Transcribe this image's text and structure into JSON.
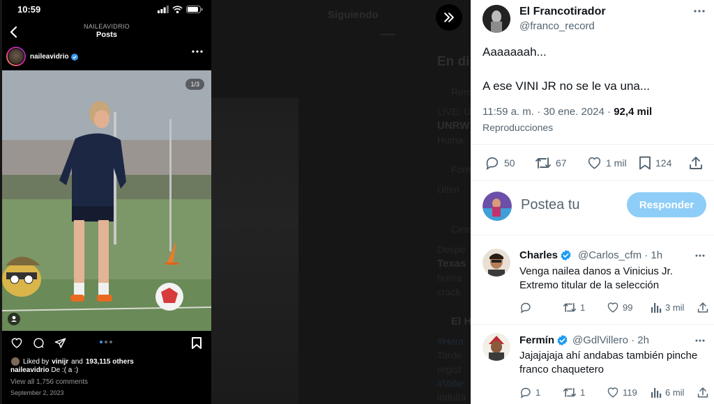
{
  "background": {
    "tab_title": "Siguiendo",
    "trending_lines": [
      "En di",
      "Rem",
      "LIVE: U",
      "UNRW",
      "Huma",
      "Fore",
      "Últim",
      "Cess",
      "Despe",
      "Texas",
      "huma",
      "crack",
      "El H",
      "#Hera",
      "Tarde",
      "regist",
      "#Valie",
      "indulta"
    ]
  },
  "instagram": {
    "time": "10:59",
    "username_header": "NAILEAVIDRIO",
    "page_title": "Posts",
    "handle": "naileavidrio",
    "photo_counter": "1/3",
    "liked_by_prefix": "Liked by",
    "liked_by_user": "vinijr",
    "liked_by_and": "and",
    "liked_by_count": "193,115 others",
    "caption_user": "naileavidrio",
    "caption_text": "De :( a :)",
    "view_comments": "View all 1,756 comments",
    "date": "September 2, 2023",
    "carousel_total": 3,
    "carousel_active": 1
  },
  "tweet": {
    "author_name": "El Francotirador",
    "author_handle": "@franco_record",
    "body_line1": "Aaaaaaah...",
    "body_line2": "A ese VINI JR no se le va una...",
    "time": "11:59 a. m. · 30 ene. 2024 ·",
    "views_count": "92,4 mil",
    "views_label": "Reproducciones",
    "replies": "50",
    "reposts": "67",
    "likes": "1 mil",
    "bookmarks": "124"
  },
  "composer": {
    "placeholder": "Postea tu",
    "reply_button": "Responder"
  },
  "replies": [
    {
      "name": "Charles",
      "handle": "@Carlos_cfm · 1h",
      "line1": "Venga nailea danos a Vinicius Jr.",
      "line2": "Extremo titular de la selección",
      "replies": "",
      "reposts": "1",
      "likes": "99",
      "views": "3 mil"
    },
    {
      "name": "Fermín",
      "handle": "@GdlVillero · 2h",
      "line1": "Jajajajaja ahí andabas también pinche",
      "line2": "franco chaquetero",
      "replies": "1",
      "reposts": "1",
      "likes": "119",
      "views": "6 mil"
    }
  ],
  "colors": {
    "x_blue": "#1d9bf0",
    "reply_button_disabled": "#8ecdf7",
    "ig_verified": "#3897f0",
    "text_primary": "#0f1419",
    "text_secondary": "#536471"
  }
}
